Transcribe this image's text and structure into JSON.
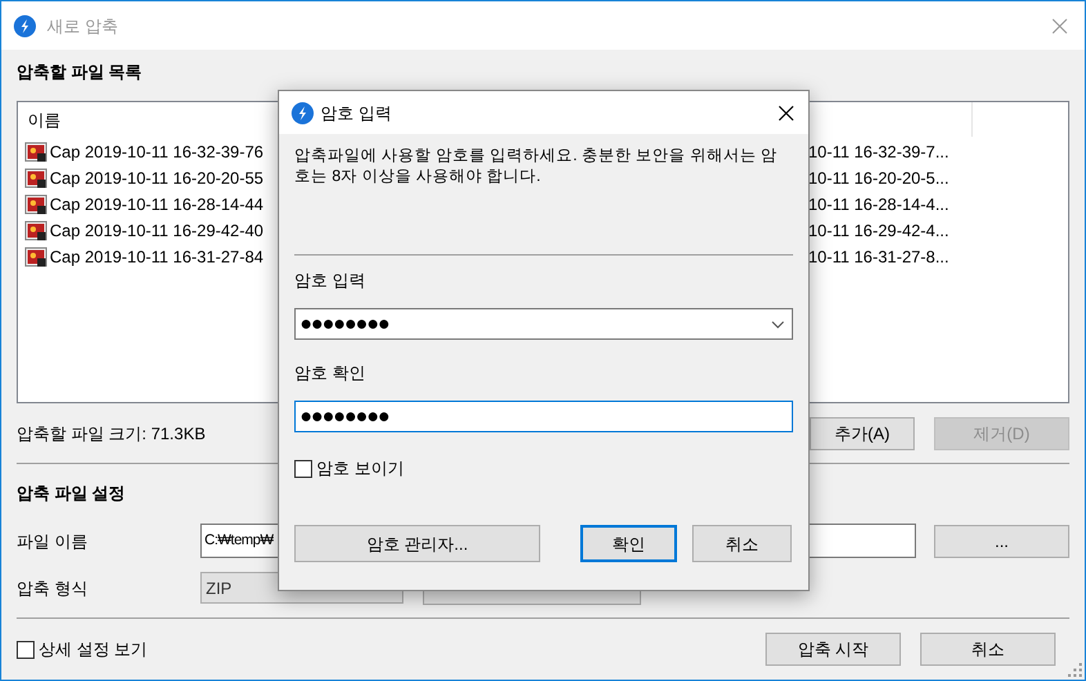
{
  "window": {
    "title": "새로 압축"
  },
  "file_list": {
    "title": "압축할 파일 목록",
    "columns": [
      "이름"
    ],
    "rows": [
      {
        "name_start": "Cap 2019-10-11 16-32-39-76",
        "name_end": "10-11 16-32-39-7..."
      },
      {
        "name_start": "Cap 2019-10-11 16-20-20-55",
        "name_end": "10-11 16-20-20-5..."
      },
      {
        "name_start": "Cap 2019-10-11 16-28-14-44",
        "name_end": "10-11 16-28-14-4..."
      },
      {
        "name_start": "Cap 2019-10-11 16-29-42-40",
        "name_end": "10-11 16-29-42-4..."
      },
      {
        "name_start": "Cap 2019-10-11 16-31-27-84",
        "name_end": "10-11 16-31-27-8..."
      }
    ]
  },
  "file_size": "압축할 파일 크기: 71.3KB",
  "list_buttons": [
    {
      "label": "추가(A)",
      "disabled": false
    },
    {
      "label": "제거(D)",
      "disabled": true
    }
  ],
  "settings": {
    "title": "압축 파일 설정",
    "file_name_label": "파일 이름",
    "file_name_value": "C:₩temp₩",
    "browse_button": "...",
    "format_label": "압축 형식",
    "format_value": "ZIP"
  },
  "show_details": {
    "label": "상세 설정 보기",
    "checked": false
  },
  "footer_buttons": [
    "압축 시작",
    "취소"
  ],
  "dialog": {
    "title": "암호 입력",
    "message": "압축파일에 사용할 암호를 입력하세요. 충분한 보안을 위해서는 암호는 8자 이상을 사용해야 합니다.",
    "password_label": "암호 입력",
    "password": "●●●●●●●●",
    "confirm_label": "암호 확인",
    "confirm": "●●●●●●●●",
    "confirm_focused": true,
    "show_password": {
      "label": "암호 보이기",
      "checked": false
    },
    "buttons": [
      {
        "label": "암호 관리자...",
        "default": false
      },
      {
        "label": "확인",
        "default": true
      },
      {
        "label": "취소",
        "default": false
      }
    ]
  }
}
